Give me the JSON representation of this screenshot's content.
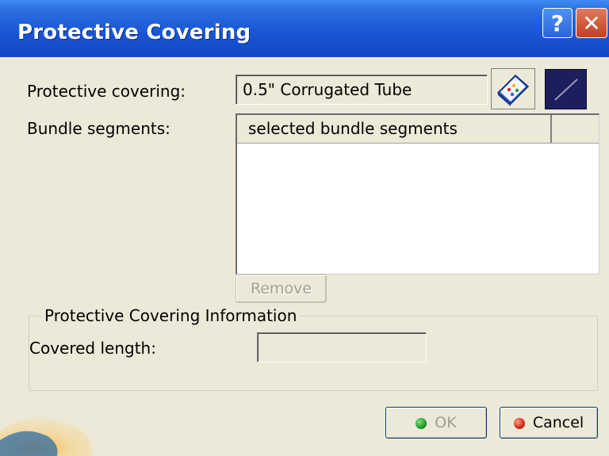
{
  "window": {
    "title": "Protective Covering",
    "help_label": "?",
    "close_label": "✕"
  },
  "fields": {
    "protective_covering_label": "Protective covering:",
    "protective_covering_value": "0.5\" Corrugated Tube",
    "bundle_segments_label": "Bundle segments:",
    "bundle_list_header": "selected bundle segments",
    "remove_label": "Remove"
  },
  "info_group": {
    "legend": "Protective Covering Information",
    "covered_length_label": "Covered length:",
    "covered_length_value": ""
  },
  "buttons": {
    "ok_label": "OK",
    "cancel_label": "Cancel"
  },
  "icons": {
    "catalog": "catalog-book-icon",
    "select_curve": "curve-line-icon",
    "ok": "green-dot-icon",
    "cancel": "red-dot-icon"
  },
  "colors": {
    "title_bar": "#1a56d6",
    "ok_dot": "#1f9a2a",
    "cancel_dot": "#d22a1a"
  }
}
